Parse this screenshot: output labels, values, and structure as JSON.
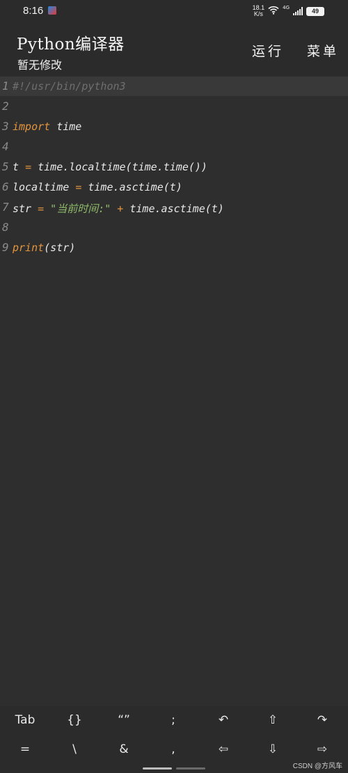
{
  "status_bar": {
    "time": "8:16",
    "net_speed_value": "18.1",
    "net_speed_unit": "K/s",
    "network_type": "4G",
    "battery": "49",
    "icons": [
      "app-notification-icon",
      "wifi-icon",
      "signal-icon",
      "battery-icon"
    ]
  },
  "app_bar": {
    "title": "Python编译器",
    "subtitle": "暂无修改",
    "run_label": "运行",
    "menu_label": "菜单"
  },
  "editor": {
    "current_line": 1,
    "lines": [
      {
        "num": "1",
        "tokens": [
          {
            "t": "#!/usr/bin/python3",
            "c": "comment"
          }
        ]
      },
      {
        "num": "2",
        "tokens": []
      },
      {
        "num": "3",
        "tokens": [
          {
            "t": "import",
            "c": "kw"
          },
          {
            "t": " time",
            "c": "plain"
          }
        ]
      },
      {
        "num": "4",
        "tokens": []
      },
      {
        "num": "5",
        "tokens": [
          {
            "t": "t ",
            "c": "plain"
          },
          {
            "t": "=",
            "c": "op"
          },
          {
            "t": " time.localtime(time.time())",
            "c": "plain"
          }
        ]
      },
      {
        "num": "6",
        "tokens": [
          {
            "t": "localtime ",
            "c": "plain"
          },
          {
            "t": "=",
            "c": "op"
          },
          {
            "t": " time.asctime(t)",
            "c": "plain"
          }
        ]
      },
      {
        "num": "7",
        "tokens": [
          {
            "t": "str ",
            "c": "plain"
          },
          {
            "t": "=",
            "c": "op"
          },
          {
            "t": " \"当前时间:\"",
            "c": "str"
          },
          {
            "t": " + ",
            "c": "op"
          },
          {
            "t": "time.asctime(t)",
            "c": "plain"
          }
        ]
      },
      {
        "num": "8",
        "tokens": []
      },
      {
        "num": "9",
        "tokens": [
          {
            "t": "print",
            "c": "fn"
          },
          {
            "t": "(str)",
            "c": "plain"
          }
        ]
      }
    ]
  },
  "keybar": {
    "row1": [
      "Tab",
      "{}",
      "“”",
      ";",
      "↶",
      "⇧",
      "↷"
    ],
    "row2": [
      "=",
      "\\",
      "&",
      ",",
      "⇦",
      "⇩",
      "⇨"
    ]
  },
  "watermark": "CSDN @方风车"
}
